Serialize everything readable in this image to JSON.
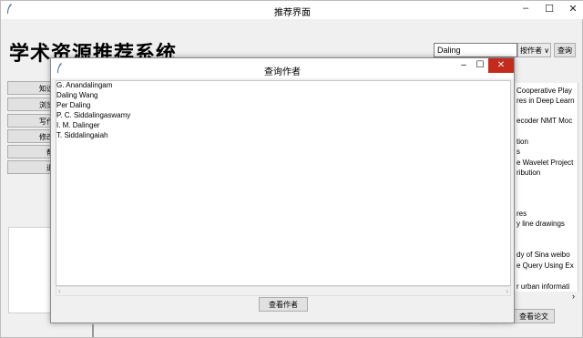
{
  "main_window": {
    "title": "推荐界面",
    "controls": [
      "–",
      "☐",
      "✕"
    ],
    "app_title": "学术资源推荐系统",
    "search": {
      "value": "Daling",
      "type": "按作者 ∨",
      "button": "查询"
    },
    "left_menu": [
      "知识",
      "浏览",
      "写作",
      "修改",
      "帮",
      "退"
    ],
    "right_list": [
      "Cooperative Play",
      "res in Deep Learn",
      "ecoder NMT Moc",
      "tion",
      "s",
      "e Wavelet Project",
      "ribution",
      "res",
      "y line drawings",
      "dy of Sina weibo",
      "e Query Using Ex",
      "r urban informati"
    ],
    "right_scroll_chevron": "›",
    "view_paper_button": "查看论文",
    "watermark": "百家号"
  },
  "dialog": {
    "title": "查询作者",
    "controls": {
      "minimize": "–",
      "maximize": "☐",
      "close": "✕"
    },
    "authors": [
      "G. Anandalingam",
      "Daling Wang",
      "Per Daling",
      "P. C. Siddalingaswamy",
      "I. M. Dalinger",
      "T. Siddalingaiah"
    ],
    "scroll_left": "‹",
    "scroll_right": "›",
    "view_author_button": "查看作者"
  }
}
